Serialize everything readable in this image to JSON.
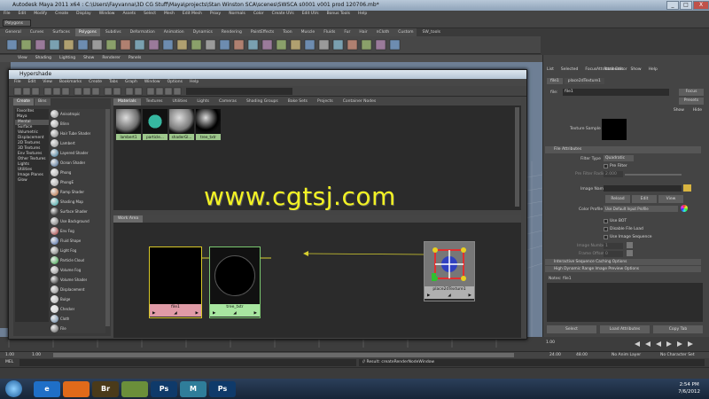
{
  "window": {
    "title": "Autodesk Maya 2011 x64 : C:\\Users\\Fayvanna\\3D CG Stuff\\Maya\\projects\\Stan Winston SCA\\scenes\\SWSCA s0001 v001 prod 120706.mb*",
    "btn_min": "_",
    "btn_max": "□",
    "btn_close": "X"
  },
  "main_menu": [
    "File",
    "Edit",
    "Modify",
    "Create",
    "Display",
    "Window",
    "Assets",
    "Select",
    "Mesh",
    "Edit Mesh",
    "Proxy",
    "Normals",
    "Color",
    "Create UVs",
    "Edit UVs",
    "Bonus Tools",
    "Help"
  ],
  "mode_selector": "Polygons",
  "shelf_tabs": [
    {
      "label": "General",
      "active": false
    },
    {
      "label": "Curves",
      "active": false
    },
    {
      "label": "Surfaces",
      "active": false
    },
    {
      "label": "Polygons",
      "active": true
    },
    {
      "label": "Subdivs",
      "active": false
    },
    {
      "label": "Deformation",
      "active": false
    },
    {
      "label": "Animation",
      "active": false
    },
    {
      "label": "Dynamics",
      "active": false
    },
    {
      "label": "Rendering",
      "active": false
    },
    {
      "label": "PaintEffects",
      "active": false
    },
    {
      "label": "Toon",
      "active": false
    },
    {
      "label": "Muscle",
      "active": false
    },
    {
      "label": "Fluids",
      "active": false
    },
    {
      "label": "Fur",
      "active": false
    },
    {
      "label": "Hair",
      "active": false
    },
    {
      "label": "nCloth",
      "active": false
    },
    {
      "label": "Custom",
      "active": false
    },
    {
      "label": "SW_tools",
      "active": false
    }
  ],
  "viewport_menu": [
    "View",
    "Shading",
    "Lighting",
    "Show",
    "Renderer",
    "Panels"
  ],
  "attribute_editor": {
    "title": "Attribute Editor",
    "menu": [
      "List",
      "Selected",
      "Focus",
      "Attributes",
      "Show",
      "Help"
    ],
    "tabs": [
      "file1",
      "place2dTexture1"
    ],
    "node_label": "file:",
    "node_value": "file1",
    "focus_btn": "Focus",
    "presets_btn": "Presets",
    "show_btn": "Show",
    "hide_btn": "Hide",
    "sample_label": "Texture Sample",
    "section_file": "File Attributes",
    "filter_type_label": "Filter Type",
    "filter_type_value": "Quadratic",
    "pre_filter_label": "Pre Filter",
    "pre_filter_radius_label": "Pre Filter Radius",
    "pre_filter_radius_value": "2.000",
    "image_name_label": "Image Name",
    "reload_btn": "Reload",
    "edit_btn": "Edit",
    "view_btn": "View",
    "color_profile_label": "Color Profile",
    "color_profile_value": "Use Default Input Profile",
    "use_bot": "Use BOT",
    "disable_file_load": "Disable File Load",
    "use_image_sequence": "Use Image Sequence",
    "image_number_label": "Image Number",
    "image_number_value": "1",
    "frame_offset_label": "Frame Offset",
    "frame_offset_value": "0",
    "section_interactive": "Interactive Sequence Caching Options",
    "section_hdr": "High Dynamic Range Image Preview Options",
    "notes_label": "Notes: file1",
    "select_btn": "Select",
    "load_attrs_btn": "Load Attributes",
    "copy_tab_btn": "Copy Tab"
  },
  "hypershade": {
    "title": "Hypershade",
    "menu": [
      "File",
      "Edit",
      "View",
      "Bookmarks",
      "Create",
      "Tabs",
      "Graph",
      "Window",
      "Options",
      "Help"
    ],
    "left_tabs": [
      {
        "label": "Create",
        "active": true
      },
      {
        "label": "Bins",
        "active": false
      }
    ],
    "tree": [
      "Favorites",
      "Maya",
      "Mental",
      "Surface",
      "Volumetric",
      "Displacement",
      "2D Textures",
      "3D Textures",
      "Env Textures",
      "Other Textures",
      "Lights",
      "Utilities",
      "Image Planes",
      "Glow"
    ],
    "nodes": [
      {
        "label": "Anisotropic",
        "color": "#8a8a8a"
      },
      {
        "label": "Blinn",
        "color": "#9a9a9a"
      },
      {
        "label": "Hair Tube Shader",
        "color": "#7a7a7a"
      },
      {
        "label": "Lambert",
        "color": "#8e8e8e"
      },
      {
        "label": "Layered Shader",
        "color": "#2f6c8f"
      },
      {
        "label": "Ocean Shader",
        "color": "#3b5f8a"
      },
      {
        "label": "Phong",
        "color": "#a8a8a8"
      },
      {
        "label": "PhongE",
        "color": "#a0a0a0"
      },
      {
        "label": "Ramp Shader",
        "color": "#b06030"
      },
      {
        "label": "Shading Map",
        "color": "#30a0a0"
      },
      {
        "label": "Surface Shader",
        "color": "#000000"
      },
      {
        "label": "Use Background",
        "color": "#6a6a6a"
      },
      {
        "label": "Env Fog",
        "color": "#a03030"
      },
      {
        "label": "Fluid Shape",
        "color": "#4060a0"
      },
      {
        "label": "Light Fog",
        "color": "#707070"
      },
      {
        "label": "Particle Cloud",
        "color": "#30a040"
      },
      {
        "label": "Volume Fog",
        "color": "#909090"
      },
      {
        "label": "Volume Shader",
        "color": "#202020"
      },
      {
        "label": "Displacement",
        "color": "#888888"
      },
      {
        "label": "Bulge",
        "color": "#b0b0b0"
      },
      {
        "label": "Checker",
        "color": "#d0d0d0"
      },
      {
        "label": "Cloth",
        "color": "#6080a0"
      },
      {
        "label": "File",
        "color": "#5c5c5c"
      }
    ],
    "top_tabs": [
      {
        "label": "Materials",
        "active": true
      },
      {
        "label": "Textures",
        "active": false
      },
      {
        "label": "Utilities",
        "active": false
      },
      {
        "label": "Lights",
        "active": false
      },
      {
        "label": "Cameras",
        "active": false
      },
      {
        "label": "Shading Groups",
        "active": false
      },
      {
        "label": "Bake Sets",
        "active": false
      },
      {
        "label": "Projects",
        "active": false
      },
      {
        "label": "Container Nodes",
        "active": false
      }
    ],
    "swatches": [
      {
        "label": "lambert1",
        "ball": "#6b6b6b",
        "labelColor": "#9ec88c"
      },
      {
        "label": "particle...",
        "ball": "#36b7a0",
        "labelColor": "#9ec88c"
      },
      {
        "label": "shaderGl...",
        "ball": "#7a7a7a",
        "labelColor": "#9ec88c"
      },
      {
        "label": "tree_txtr",
        "ball": "#000000",
        "labelColor": "#9ec88c"
      }
    ],
    "work_tab": "Work Area",
    "work_nodes": [
      {
        "name": "file1",
        "color": "#e09aa6"
      },
      {
        "name": "tree_txtr",
        "color": "#a8e6a0"
      },
      {
        "name": "place2dTexture1",
        "color": "#b0b0b0"
      }
    ]
  },
  "timeline": {
    "start": "1.00",
    "current": "1.00",
    "range_start": "1.00",
    "range_end": "24.00",
    "end": "48.00",
    "anim_layer": "No Anim Layer",
    "char_set": "No Character Set"
  },
  "command_result": "// Result: createRenderNodeWindow",
  "mel_label": "MEL",
  "watermark": "www.cgtsj.com",
  "taskbar": {
    "time": "2:54 PM",
    "date": "7/6/2012",
    "apps": [
      {
        "label": "e",
        "color": "#1f6fc7"
      },
      {
        "label": "",
        "color": "#e06a1a"
      },
      {
        "label": "Br",
        "color": "#4a3a1a"
      },
      {
        "label": "",
        "color": "#6b8f3a"
      },
      {
        "label": "Ps",
        "color": "#0f3a6a"
      },
      {
        "label": "M",
        "color": "#2f7d9a"
      },
      {
        "label": "Ps",
        "color": "#0f3a6a"
      }
    ]
  }
}
